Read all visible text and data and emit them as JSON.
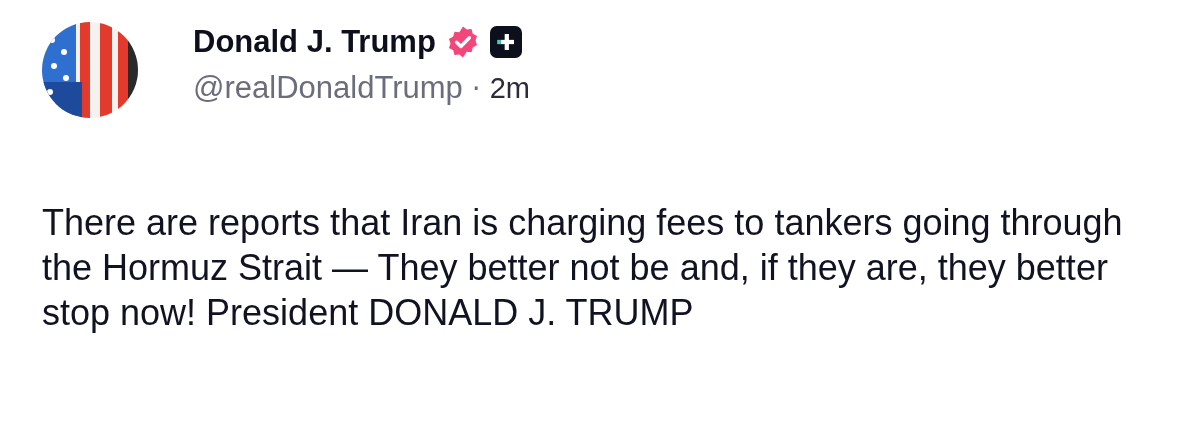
{
  "post": {
    "author": {
      "name": "Donald J. Trump",
      "handle": "@realDonaldTrump",
      "separator": "·",
      "time": "2m"
    },
    "text": "There are reports that Iran is charging fees to tankers going through the Hormuz Strait — They better not be and, if they are, they better stop now! President DONALD J. TRUMP"
  }
}
